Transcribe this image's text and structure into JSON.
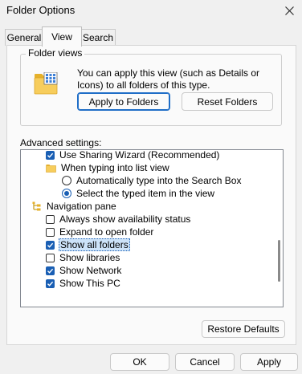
{
  "window": {
    "title": "Folder Options"
  },
  "tabs": [
    {
      "label": "General",
      "active": false
    },
    {
      "label": "View",
      "active": true
    },
    {
      "label": "Search",
      "active": false
    }
  ],
  "folder_views": {
    "group_label": "Folder views",
    "description": "You can apply this view (such as Details or Icons) to all folders of this type.",
    "apply_button": "Apply to Folders",
    "reset_button": "Reset Folders"
  },
  "advanced": {
    "label": "Advanced settings:",
    "items": [
      {
        "type": "checkbox",
        "checked": true,
        "label": "Use Sharing Wizard (Recommended)"
      },
      {
        "type": "folder",
        "label": "When typing into list view"
      },
      {
        "type": "radio",
        "checked": false,
        "label": "Automatically type into the Search Box"
      },
      {
        "type": "radio",
        "checked": true,
        "label": "Select the typed item in the view"
      },
      {
        "type": "nav",
        "label": "Navigation pane"
      },
      {
        "type": "checkbox",
        "checked": false,
        "label": "Always show availability status"
      },
      {
        "type": "checkbox",
        "checked": false,
        "label": "Expand to open folder"
      },
      {
        "type": "checkbox",
        "checked": true,
        "label": "Show all folders",
        "selected": true
      },
      {
        "type": "checkbox",
        "checked": false,
        "label": "Show libraries"
      },
      {
        "type": "checkbox",
        "checked": true,
        "label": "Show Network"
      },
      {
        "type": "checkbox",
        "checked": true,
        "label": "Show This PC"
      }
    ],
    "restore_button": "Restore Defaults"
  },
  "footer": {
    "ok": "OK",
    "cancel": "Cancel",
    "apply": "Apply"
  },
  "icons": {
    "close": "close-icon",
    "folder_views": "folder-grid-icon"
  },
  "colors": {
    "accent": "#1a5fb4",
    "selection_bg": "#cde3f9"
  }
}
